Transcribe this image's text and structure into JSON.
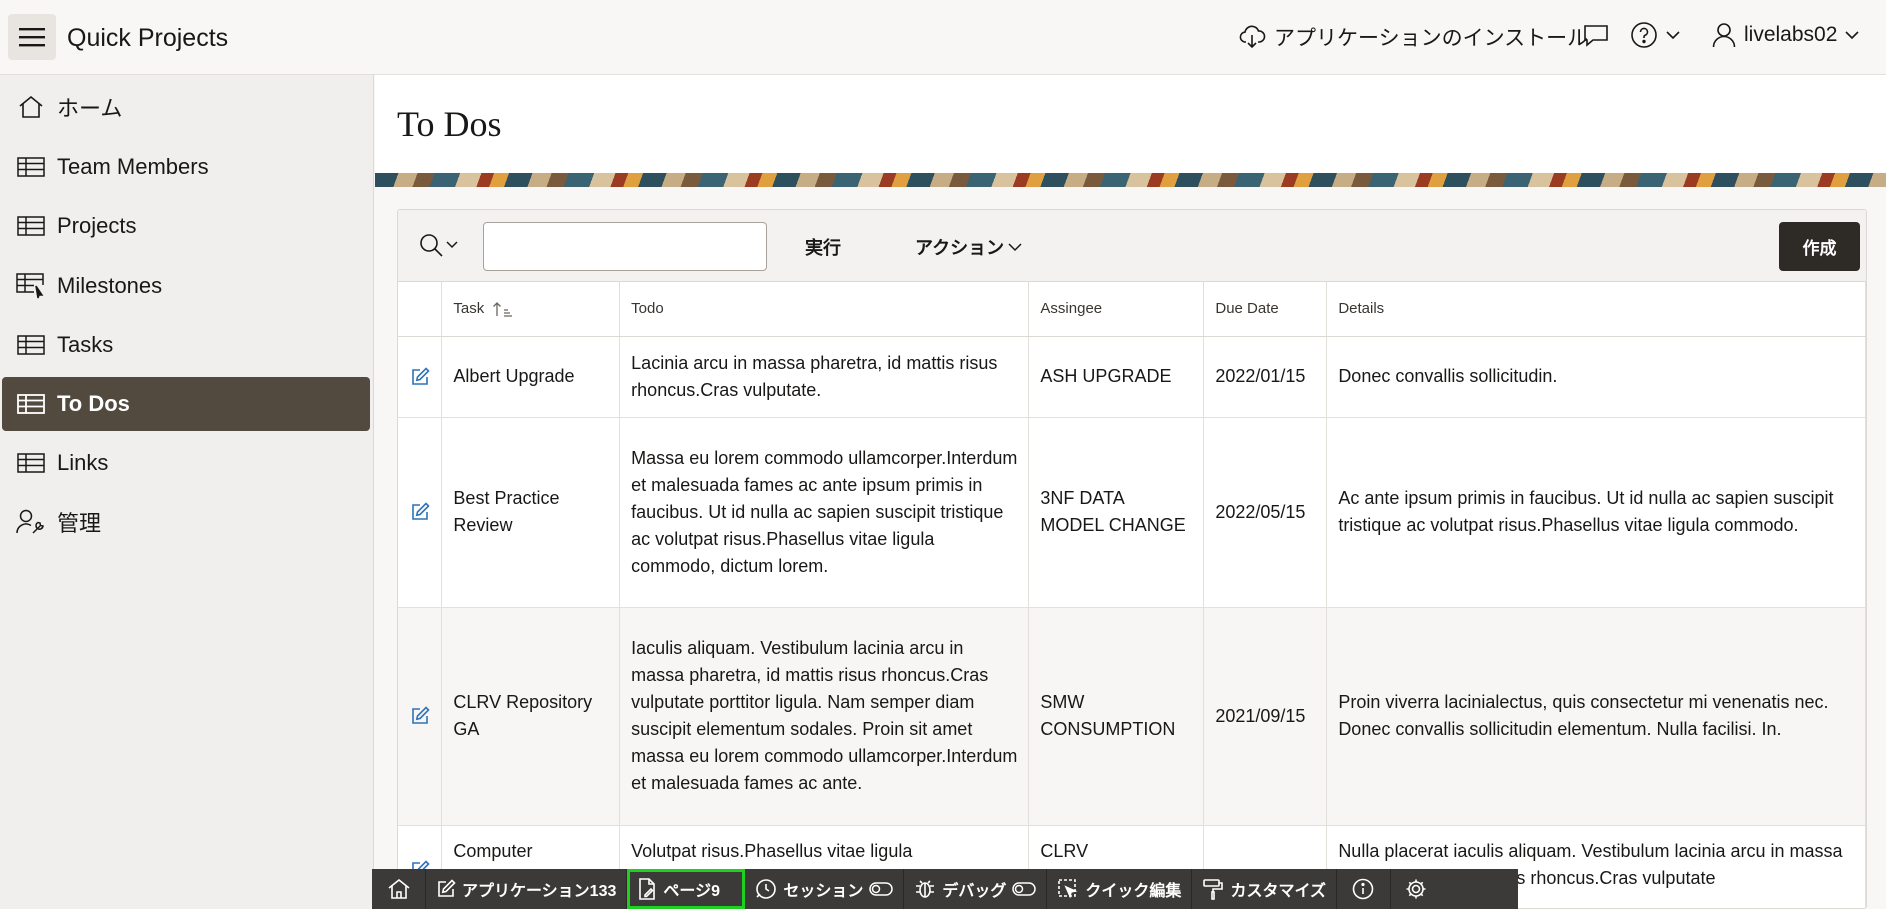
{
  "header": {
    "app_title": "Quick Projects",
    "install_label": "アプリケーションのインストール",
    "user_name": "livelabs02"
  },
  "sidebar": {
    "items": [
      {
        "label": "ホーム",
        "icon": "home-icon"
      },
      {
        "label": "Team Members",
        "icon": "table-icon"
      },
      {
        "label": "Projects",
        "icon": "table-icon"
      },
      {
        "label": "Milestones",
        "icon": "table-pointer-icon"
      },
      {
        "label": "Tasks",
        "icon": "table-icon"
      },
      {
        "label": "To Dos",
        "icon": "table-icon",
        "active": true
      },
      {
        "label": "Links",
        "icon": "table-icon"
      },
      {
        "label": "管理",
        "icon": "admin-icon"
      }
    ]
  },
  "page": {
    "title": "To Dos"
  },
  "report": {
    "search_placeholder": "",
    "go_label": "実行",
    "actions_label": "アクション",
    "create_label": "作成",
    "columns": [
      "Task",
      "Todo",
      "Assingee",
      "Due Date",
      "Details"
    ],
    "rows": [
      {
        "task": "Albert Upgrade",
        "todo": "Lacinia arcu in massa pharetra, id mattis risus rhoncus.Cras vulputate.",
        "assignee": "ASH UPGRADE",
        "due": "2022/01/15",
        "details": "Donec convallis sollicitudin."
      },
      {
        "task": "Best Practice Review",
        "todo": "Massa eu lorem commodo ullamcorper.Interdum et malesuada fames ac ante ipsum primis in faucibus. Ut id nulla ac sapien suscipit tristique ac volutpat risus.Phasellus vitae ligula commodo, dictum lorem.",
        "assignee": "3NF DATA MODEL CHANGE",
        "due": "2022/05/15",
        "details": "Ac ante ipsum primis in faucibus. Ut id nulla ac sapien suscipit tristique ac volutpat risus.Phasellus vitae ligula commodo."
      },
      {
        "task": "CLRV Repository GA",
        "todo": "Iaculis aliquam. Vestibulum lacinia arcu in massa pharetra, id mattis risus rhoncus.Cras vulputate porttitor ligula. Nam semper diam suscipit elementum sodales. Proin sit amet massa eu lorem commodo ullamcorper.Interdum et malesuada fames ac ante.",
        "assignee": "SMW CONSUMPTION",
        "due": "2021/09/15",
        "details": "Proin viverra lacinialectus, quis consectetur mi venenatis nec. Donec convallis sollicitudin elementum. Nulla facilisi. In."
      },
      {
        "task": "Computer",
        "todo": "Volutpat risus.Phasellus vitae ligula",
        "assignee": "CLRV",
        "due": "",
        "details": "Nulla placerat iaculis aliquam. Vestibulum lacinia arcu in massa pharetra, id mattis risus rhoncus.Cras vulputate"
      }
    ]
  },
  "devbar": {
    "application": "アプリケーション133",
    "page": "ページ9",
    "session": "セッション",
    "debug": "デバッグ",
    "quick_edit": "クイック編集",
    "customize": "カスタマイズ"
  },
  "colors": {
    "active_nav": "#52493f",
    "create_button": "#2e2a26",
    "devbar": "#3c3a38",
    "devbar_highlight": "#1fd11f"
  }
}
